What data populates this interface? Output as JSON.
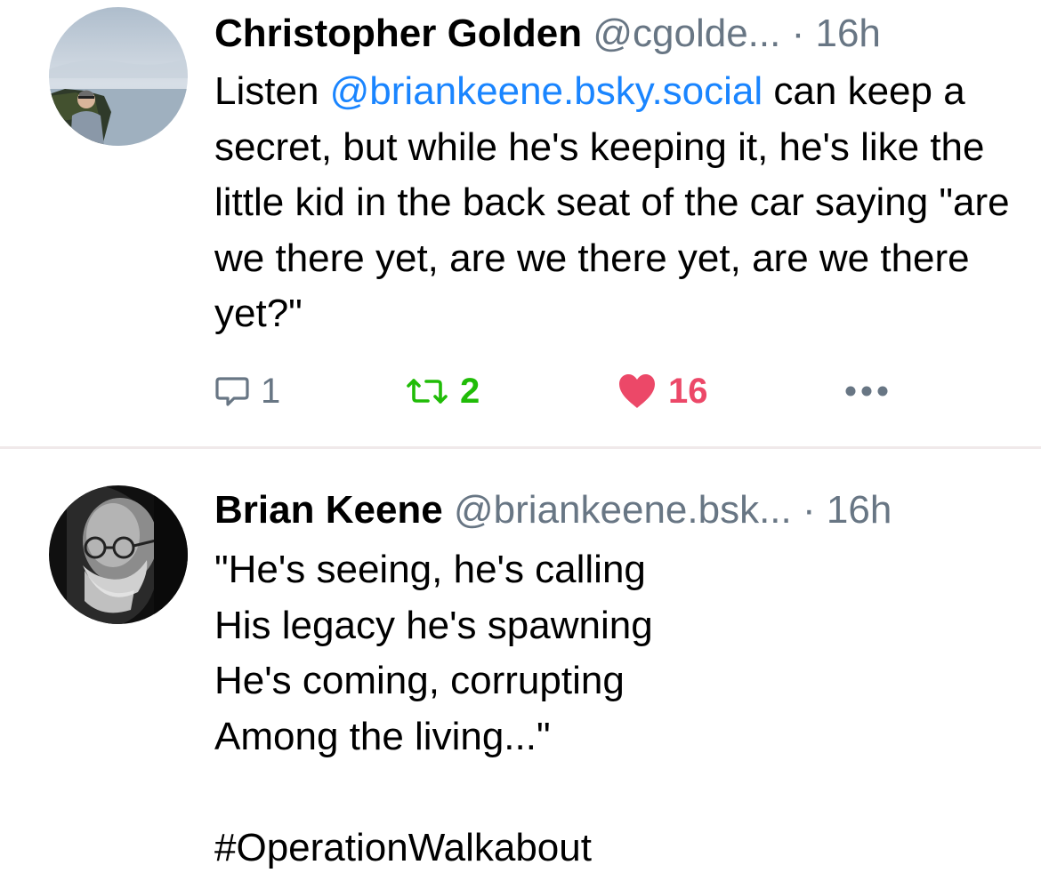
{
  "posts": [
    {
      "author": {
        "display_name": "Christopher Golden",
        "handle": "@cgolde...",
        "avatar_icon": "avatar-photo-cliffs"
      },
      "separator": "·",
      "time": "16h",
      "text": {
        "prefix": "Listen ",
        "mention": "@briankeene.bsky.social",
        "suffix": " can keep a secret, but while he's keeping it, he's like the little kid in the back seat of the car saying \"are we there yet, are we there yet, are we there yet?\""
      },
      "stats": {
        "replies": "1",
        "reposts": "2",
        "likes": "16"
      },
      "icons": {
        "reply": "comment-bubble-icon",
        "repost": "repost-arrows-icon",
        "like": "heart-icon",
        "more": "more-dots-icon"
      }
    },
    {
      "author": {
        "display_name": "Brian Keene",
        "handle": "@briankeene.bsk...",
        "avatar_icon": "avatar-photo-bw-portrait"
      },
      "separator": "·",
      "time": "16h",
      "text": "\"He's seeing, he's calling\nHis legacy he's spawning\nHe's coming, corrupting\nAmong the living...\"\n\n#OperationWalkabout"
    }
  ],
  "colors": {
    "mention": "#1a85ff",
    "secondary_text": "#687684",
    "repost_active": "#20bc07",
    "like_active": "#ec4868",
    "divider": "#f0e9ea"
  }
}
